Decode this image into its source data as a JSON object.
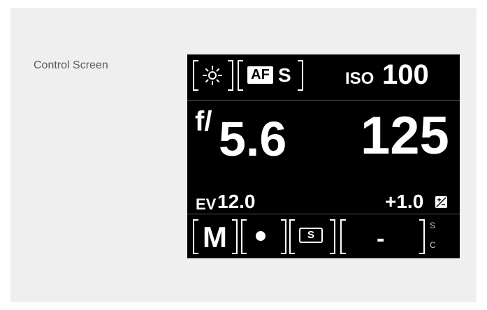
{
  "caption": "Control Screen",
  "top_row": {
    "mode_icon": "sun-icon",
    "af_badge": "AF",
    "af_mode": "S",
    "iso_label": "ISO",
    "iso_value": "100"
  },
  "exposure": {
    "aperture_prefix": "f/",
    "aperture": "5.6",
    "shutter": "125"
  },
  "ev_row": {
    "ev_label": "EV",
    "ev_value": "12.0",
    "comp_value": "+1.0",
    "comp_icon": "exposure-compensation-icon"
  },
  "bottom_row": {
    "exposure_mode": "M",
    "metering_icon": "metering-dot-icon",
    "drive_label": "S",
    "dash": "-",
    "side_top": "S",
    "side_bottom": "C"
  }
}
